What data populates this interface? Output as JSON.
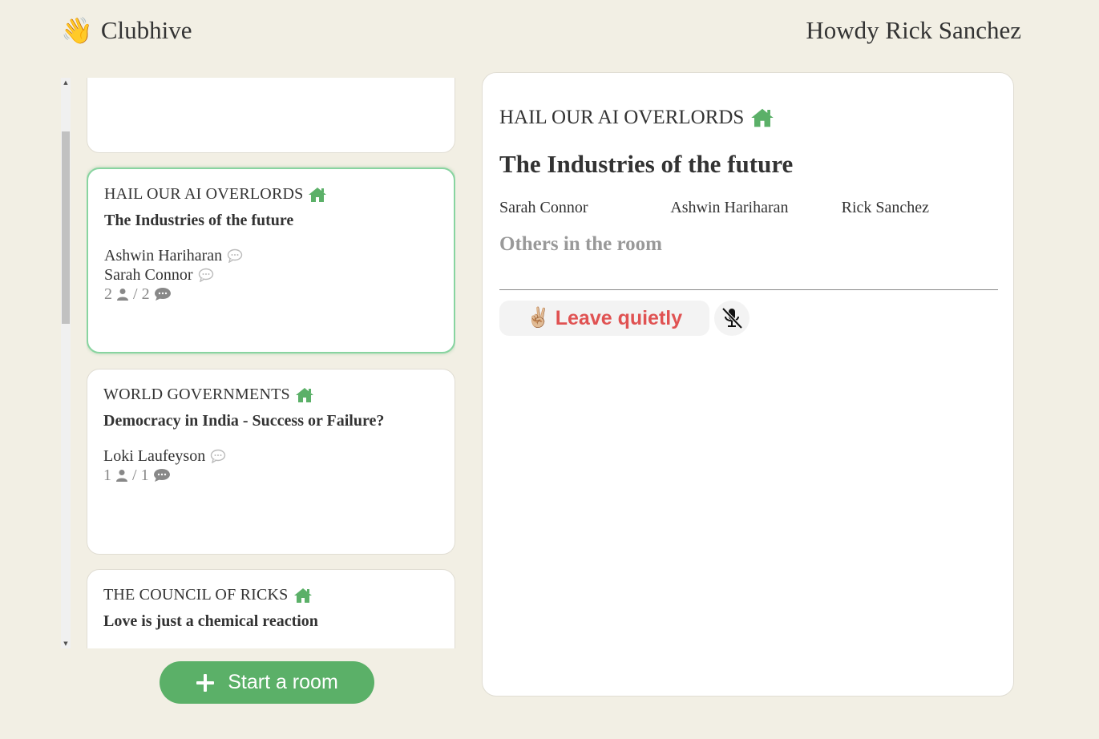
{
  "header": {
    "logo_text": "Clubhive",
    "greeting": "Howdy Rick Sanchez"
  },
  "rooms": [
    {
      "club": "HAIL OUR AI OVERLORDS",
      "title": "The Industries of the future",
      "people": [
        "Ashwin Hariharan",
        "Sarah Connor"
      ],
      "listeners": "2",
      "speakers": "2",
      "active": true
    },
    {
      "club": "WORLD GOVERNMENTS",
      "title": "Democracy in India - Success or Failure?",
      "people": [
        "Loki Laufeyson"
      ],
      "listeners": "1",
      "speakers": "1",
      "active": false
    },
    {
      "club": "THE COUNCIL OF RICKS",
      "title": "Love is just a chemical reaction",
      "people": [],
      "listeners": "",
      "speakers": "",
      "active": false
    }
  ],
  "count_separator": "/",
  "start_room_label": "Start a room",
  "panel": {
    "club": "HAIL OUR AI OVERLORDS",
    "title": "The Industries of the future",
    "speakers": [
      "Sarah Connor",
      "Ashwin Hariharan",
      "Rick Sanchez"
    ],
    "others_heading": "Others in the room",
    "leave_label": "Leave quietly"
  },
  "icons": {
    "logo": "waving-hand-icon",
    "club": "home-icon",
    "speaker": "chat-bubble-icon",
    "listener": "person-icon",
    "start": "plus-icon",
    "leave": "peace-hand-icon",
    "mute": "mic-off-icon"
  },
  "colors": {
    "background": "#f2efe4",
    "accent_green": "#5bb068",
    "leave_red": "#e05252",
    "muted_gray": "#999999"
  }
}
